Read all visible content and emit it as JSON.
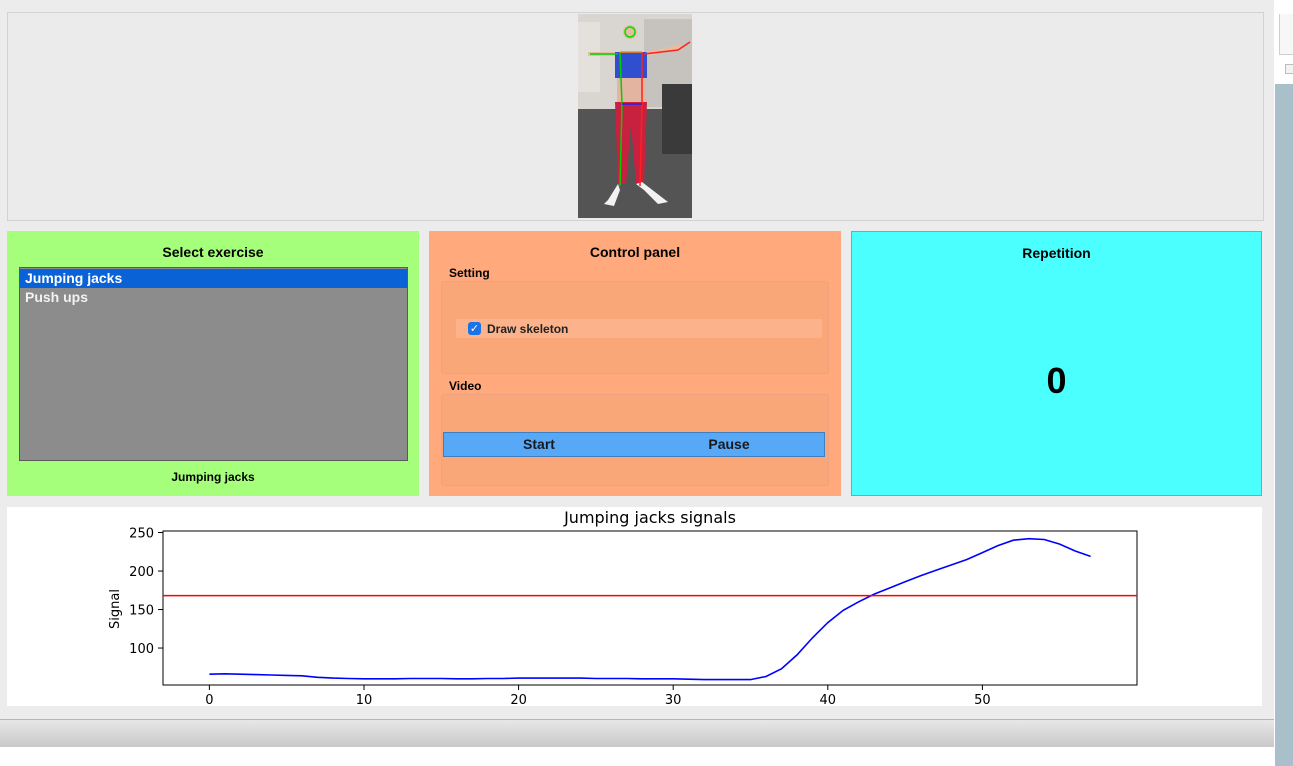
{
  "exercise_panel": {
    "title": "Select exercise",
    "items": [
      {
        "label": "Jumping jacks",
        "selected": true
      },
      {
        "label": "Push ups",
        "selected": false
      }
    ],
    "selected_caption": "Jumping jacks"
  },
  "control_panel": {
    "title": "Control panel",
    "setting_label": "Setting",
    "draw_skeleton_label": "Draw skeleton",
    "draw_skeleton_checked": true,
    "video_label": "Video",
    "start_label": "Start",
    "pause_label": "Pause"
  },
  "repetition_panel": {
    "title": "Repetition",
    "count": "0"
  },
  "colors": {
    "exercise_bg": "#a5ff7a",
    "control_bg": "#ffa97c",
    "repetition_bg": "#4bffff",
    "selected_item": "#0a63d6",
    "signal_line": "#0000ff",
    "threshold_line": "#ff0000"
  },
  "chart_data": {
    "type": "line",
    "title": "Jumping jacks signals",
    "xlabel": "",
    "ylabel": "Signal",
    "xlim": [
      -3,
      60
    ],
    "ylim": [
      52,
      252
    ],
    "xticks": [
      0,
      10,
      20,
      30,
      40,
      50
    ],
    "yticks": [
      100,
      150,
      200,
      250
    ],
    "threshold": 168,
    "series": [
      {
        "values_x": [
          0,
          1,
          2,
          3,
          4,
          5,
          6,
          7,
          8,
          9,
          10,
          11,
          12,
          13,
          14,
          15,
          16,
          17,
          18,
          19,
          20,
          21,
          22,
          23,
          24,
          25,
          26,
          27,
          28,
          29,
          30,
          31,
          32,
          33,
          34,
          35,
          36,
          37,
          38,
          39,
          40,
          41,
          42,
          43,
          44,
          45,
          46,
          47,
          48,
          49,
          50,
          51,
          52,
          53,
          54,
          55,
          56,
          57
        ],
        "values_y": [
          66,
          66.5,
          66,
          65.5,
          65,
          64.5,
          64,
          62,
          61,
          60.5,
          60,
          60,
          60,
          60.5,
          60.5,
          60.5,
          60,
          60,
          60.5,
          60.5,
          61,
          61,
          61,
          61,
          61,
          60.5,
          60.5,
          60.5,
          60,
          60,
          60,
          59.5,
          59,
          59,
          59,
          59,
          63,
          73,
          91,
          113,
          133,
          149,
          160,
          170,
          178,
          186,
          194,
          201,
          208,
          215,
          224,
          233,
          240,
          242,
          241,
          235,
          226,
          219
        ]
      }
    ]
  }
}
